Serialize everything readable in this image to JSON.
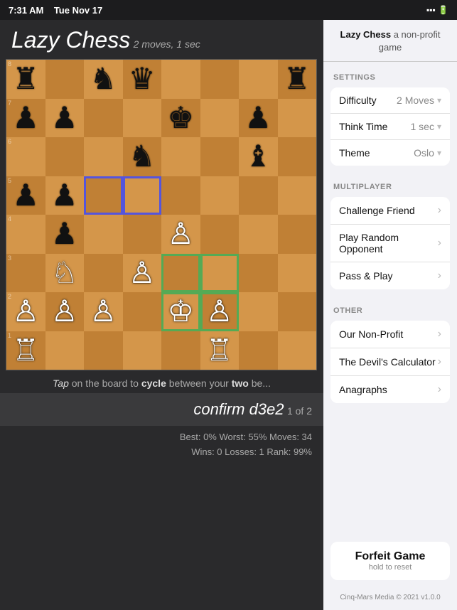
{
  "statusBar": {
    "time": "7:31 AM",
    "date": "Tue Nov 17",
    "icons": "●●●"
  },
  "appTitle": {
    "title": "Lazy Chess",
    "subtitle": "2 moves, 1 sec"
  },
  "board": {
    "pieces": [
      {
        "row": 0,
        "col": 0,
        "piece": "♜",
        "side": "black"
      },
      {
        "row": 0,
        "col": 2,
        "piece": "♞",
        "side": "black"
      },
      {
        "row": 0,
        "col": 3,
        "piece": "♛",
        "side": "black"
      },
      {
        "row": 0,
        "col": 7,
        "piece": "♜",
        "side": "black"
      },
      {
        "row": 1,
        "col": 0,
        "piece": "♟",
        "side": "black"
      },
      {
        "row": 1,
        "col": 1,
        "piece": "♟",
        "side": "black"
      },
      {
        "row": 1,
        "col": 4,
        "piece": "♚",
        "side": "black"
      },
      {
        "row": 1,
        "col": 6,
        "piece": "♟",
        "side": "black"
      },
      {
        "row": 2,
        "col": 3,
        "piece": "♞",
        "side": "black"
      },
      {
        "row": 2,
        "col": 6,
        "piece": "♝",
        "side": "black"
      },
      {
        "row": 3,
        "col": 0,
        "piece": "♟",
        "side": "black"
      },
      {
        "row": 3,
        "col": 1,
        "piece": "♟",
        "side": "black"
      },
      {
        "row": 4,
        "col": 1,
        "piece": "♟",
        "side": "black"
      },
      {
        "row": 4,
        "col": 4,
        "piece": "♙",
        "side": "white"
      },
      {
        "row": 5,
        "col": 1,
        "piece": "♘",
        "side": "white"
      },
      {
        "row": 5,
        "col": 3,
        "piece": "♙",
        "side": "white"
      },
      {
        "row": 6,
        "col": 0,
        "piece": "♙",
        "side": "white"
      },
      {
        "row": 6,
        "col": 1,
        "piece": "♙",
        "side": "white"
      },
      {
        "row": 6,
        "col": 2,
        "piece": "♙",
        "side": "white"
      },
      {
        "row": 6,
        "col": 4,
        "piece": "♔",
        "side": "white"
      },
      {
        "row": 6,
        "col": 5,
        "piece": "♙",
        "side": "white"
      },
      {
        "row": 7,
        "col": 0,
        "piece": "♖",
        "side": "white"
      },
      {
        "row": 7,
        "col": 5,
        "piece": "♖",
        "side": "white"
      }
    ],
    "highlightBlue": [
      {
        "row": 3,
        "col": 2
      },
      {
        "row": 3,
        "col": 3
      }
    ],
    "highlightGreen": [
      {
        "row": 5,
        "col": 4
      },
      {
        "row": 5,
        "col": 5
      },
      {
        "row": 6,
        "col": 4
      },
      {
        "row": 6,
        "col": 5
      }
    ]
  },
  "hintText": "Tap on the board to cycle between your two be",
  "confirmBar": {
    "move": "confirm d3e2",
    "count": "1 of 2"
  },
  "stats": {
    "line1": "Best: 0%   Worst: 55%   Moves: 34",
    "line2": "Wins: 0   Losses: 1   Rank: 99%"
  },
  "panelHeader": {
    "appName": "Lazy Chess",
    "nonprofit": " a non-profit game"
  },
  "settings": {
    "sectionLabel": "SETTINGS",
    "rows": [
      {
        "label": "Difficulty",
        "value": "2 Moves"
      },
      {
        "label": "Think Time",
        "value": "1 sec"
      },
      {
        "label": "Theme",
        "value": "Oslo"
      }
    ]
  },
  "multiplayer": {
    "sectionLabel": "MULTIPLAYER",
    "items": [
      {
        "label": "Challenge Friend"
      },
      {
        "label": "Play Random Opponent"
      },
      {
        "label": "Pass & Play"
      }
    ]
  },
  "other": {
    "sectionLabel": "OTHER",
    "items": [
      {
        "label": "Our Non-Profit"
      },
      {
        "label": "The Devil's Calculator"
      },
      {
        "label": "Anagraphs"
      }
    ]
  },
  "forfeit": {
    "label": "Forfeit Game",
    "sublabel": "hold to reset"
  },
  "footer": {
    "text": "Cinq-Mars Media © 2021 v1.0.0"
  }
}
